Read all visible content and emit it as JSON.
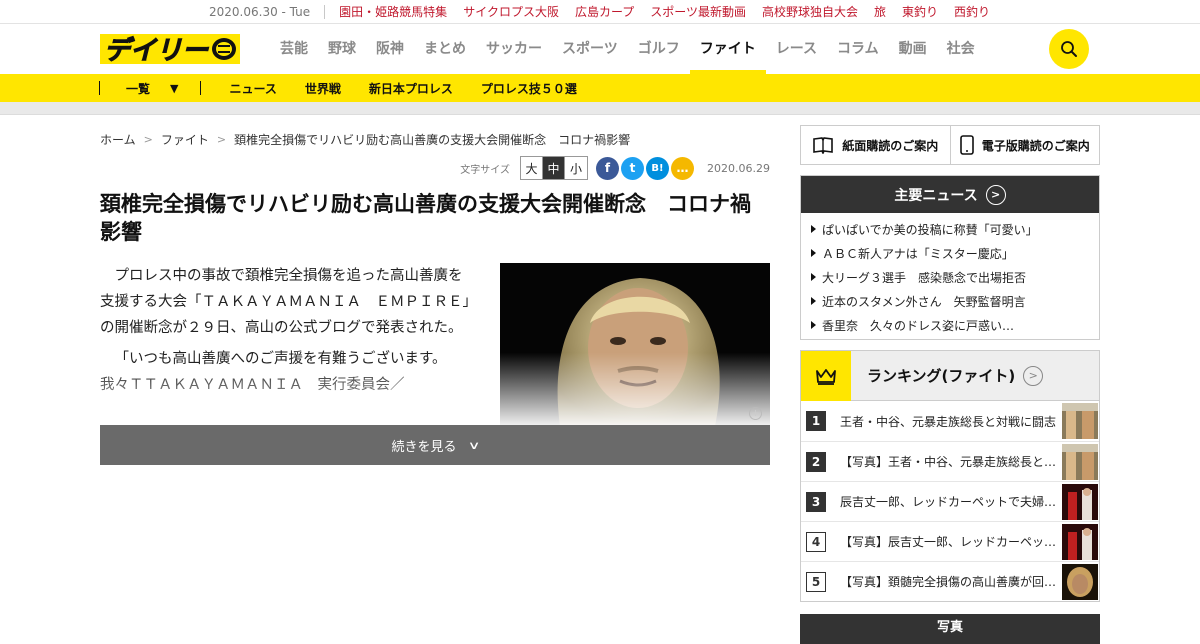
{
  "topbar": {
    "date": "2020.06.30 - Tue",
    "links": [
      "園田・姫路競馬特集",
      "サイクロプス大阪",
      "広島カープ",
      "スポーツ最新動画",
      "高校野球独自大会",
      "旅",
      "東釣り",
      "西釣り"
    ]
  },
  "header": {
    "logo_text": "デイリー",
    "nav": [
      "芸能",
      "野球",
      "阪神",
      "まとめ",
      "サッカー",
      "スポーツ",
      "ゴルフ",
      "ファイト",
      "レース",
      "コラム",
      "動画",
      "社会"
    ],
    "active_nav": "ファイト"
  },
  "subnav": {
    "list_label": "一覧",
    "items": [
      "ニュース",
      "世界戦",
      "新日本プロレス",
      "プロレス技５０選"
    ]
  },
  "breadcrumb": [
    "ホーム",
    "ファイト",
    "頚椎完全損傷でリハビリ励む高山善廣の支援大会開催断念　コロナ禍影響"
  ],
  "tools": {
    "font_size_label": "文字サイズ",
    "sizes": [
      "大",
      "中",
      "小"
    ],
    "share": [
      "f",
      "t",
      "B!",
      "…"
    ],
    "date": "2020.06.29"
  },
  "article": {
    "headline": "頚椎完全損傷でリハビリ励む高山善廣の支援大会開催断念　コロナ禍影響",
    "paragraphs": [
      "プロレス中の事故で頚椎完全損傷を追った高山善廣を支援する大会「ＴＡＫＡＹＡＭＡＮＩＡ　ＥＭＰＩＲＥ」の開催断念が２９日、高山の公式ブログで発表された。",
      "「いつも高山善廣へのご声援を有難うございます。我々ＴＴＡＫＡＹＡＭＡＮＩＡ　実行委員会／"
    ],
    "more_label": "続きを見る"
  },
  "sidebar": {
    "subscribe_paper": "紙面購読のご案内",
    "subscribe_digital": "電子版購読のご案内",
    "news_title": "主要ニュース",
    "news": [
      "ぱいぱいでか美の投稿に称賛「可愛い」",
      "ＡＢＣ新人アナは「ミスター慶応」",
      "大リーグ３選手　感染懸念で出場拒否",
      "近本のスタメン外さん　矢野監督明言",
      "香里奈　久々のドレス姿に戸惑い…"
    ],
    "ranking_title": "ランキング(ファイト)",
    "ranking": [
      {
        "no": "1",
        "text": "王者・中谷、元暴走族総長と対戦に闘志"
      },
      {
        "no": "2",
        "text": "【写真】王者・中谷、元暴走族総長と…"
      },
      {
        "no": "3",
        "text": "辰吉丈一郎、レッドカーペットで夫婦…"
      },
      {
        "no": "4",
        "text": "【写真】辰吉丈一郎、レッドカーペッ…"
      },
      {
        "no": "5",
        "text": "【写真】頚髄完全損傷の高山善廣が回…"
      }
    ],
    "photo_title": "写真"
  },
  "colors": {
    "brand_yellow": "#ffe600",
    "top_link_red": "#c0182d",
    "dark_header": "#333333",
    "more_button": "#6a6a6a"
  }
}
